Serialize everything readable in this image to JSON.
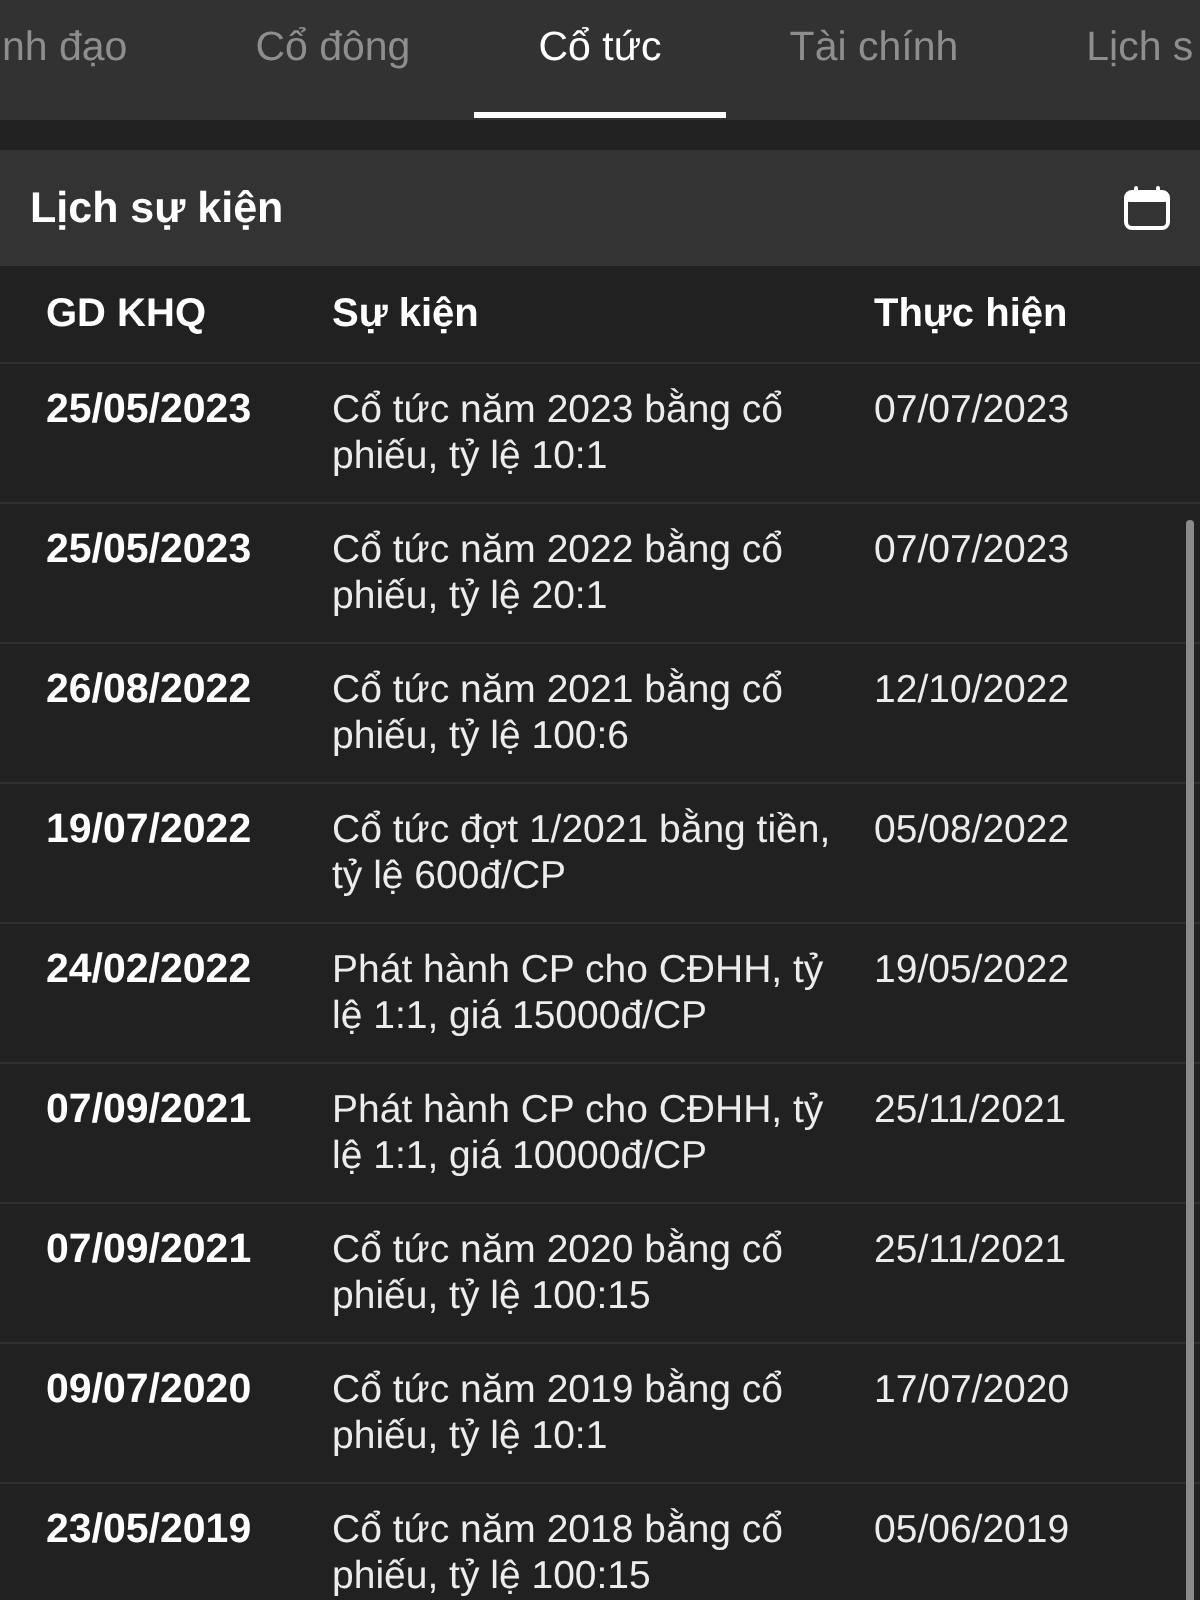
{
  "tabs": [
    {
      "label": "nh đạo",
      "selected": false
    },
    {
      "label": "Cổ đông",
      "selected": false
    },
    {
      "label": "Cổ tức",
      "selected": true
    },
    {
      "label": "Tài chính",
      "selected": false
    },
    {
      "label": "Lịch s",
      "selected": false
    }
  ],
  "section": {
    "title": "Lịch sự kiện"
  },
  "table": {
    "columns": [
      "GD KHQ",
      "Sự kiện",
      "Thực hiện"
    ],
    "rows": [
      [
        "25/05/2023",
        "Cổ tức năm 2023 bằng cổ phiếu, tỷ lệ 10:1",
        "07/07/2023"
      ],
      [
        "25/05/2023",
        "Cổ tức năm 2022 bằng cổ phiếu, tỷ lệ 20:1",
        "07/07/2023"
      ],
      [
        "26/08/2022",
        "Cổ tức năm 2021 bằng cổ phiếu, tỷ lệ 100:6",
        "12/10/2022"
      ],
      [
        "19/07/2022",
        "Cổ tức đợt 1/2021 bằng tiền, tỷ lệ 600đ/CP",
        "05/08/2022"
      ],
      [
        "24/02/2022",
        "Phát hành CP cho CĐHH, tỷ lệ 1:1, giá 15000đ/CP",
        "19/05/2022"
      ],
      [
        "07/09/2021",
        "Phát hành CP cho CĐHH, tỷ lệ 1:1, giá 10000đ/CP",
        "25/11/2021"
      ],
      [
        "07/09/2021",
        "Cổ tức năm 2020 bằng cổ phiếu, tỷ lệ 100:15",
        "25/11/2021"
      ],
      [
        "09/07/2020",
        "Cổ tức năm 2019 bằng cổ phiếu, tỷ lệ 10:1",
        "17/07/2020"
      ],
      [
        "23/05/2019",
        "Cổ tức năm 2018 bằng cổ phiếu, tỷ lệ 100:15",
        "05/06/2019"
      ]
    ]
  }
}
